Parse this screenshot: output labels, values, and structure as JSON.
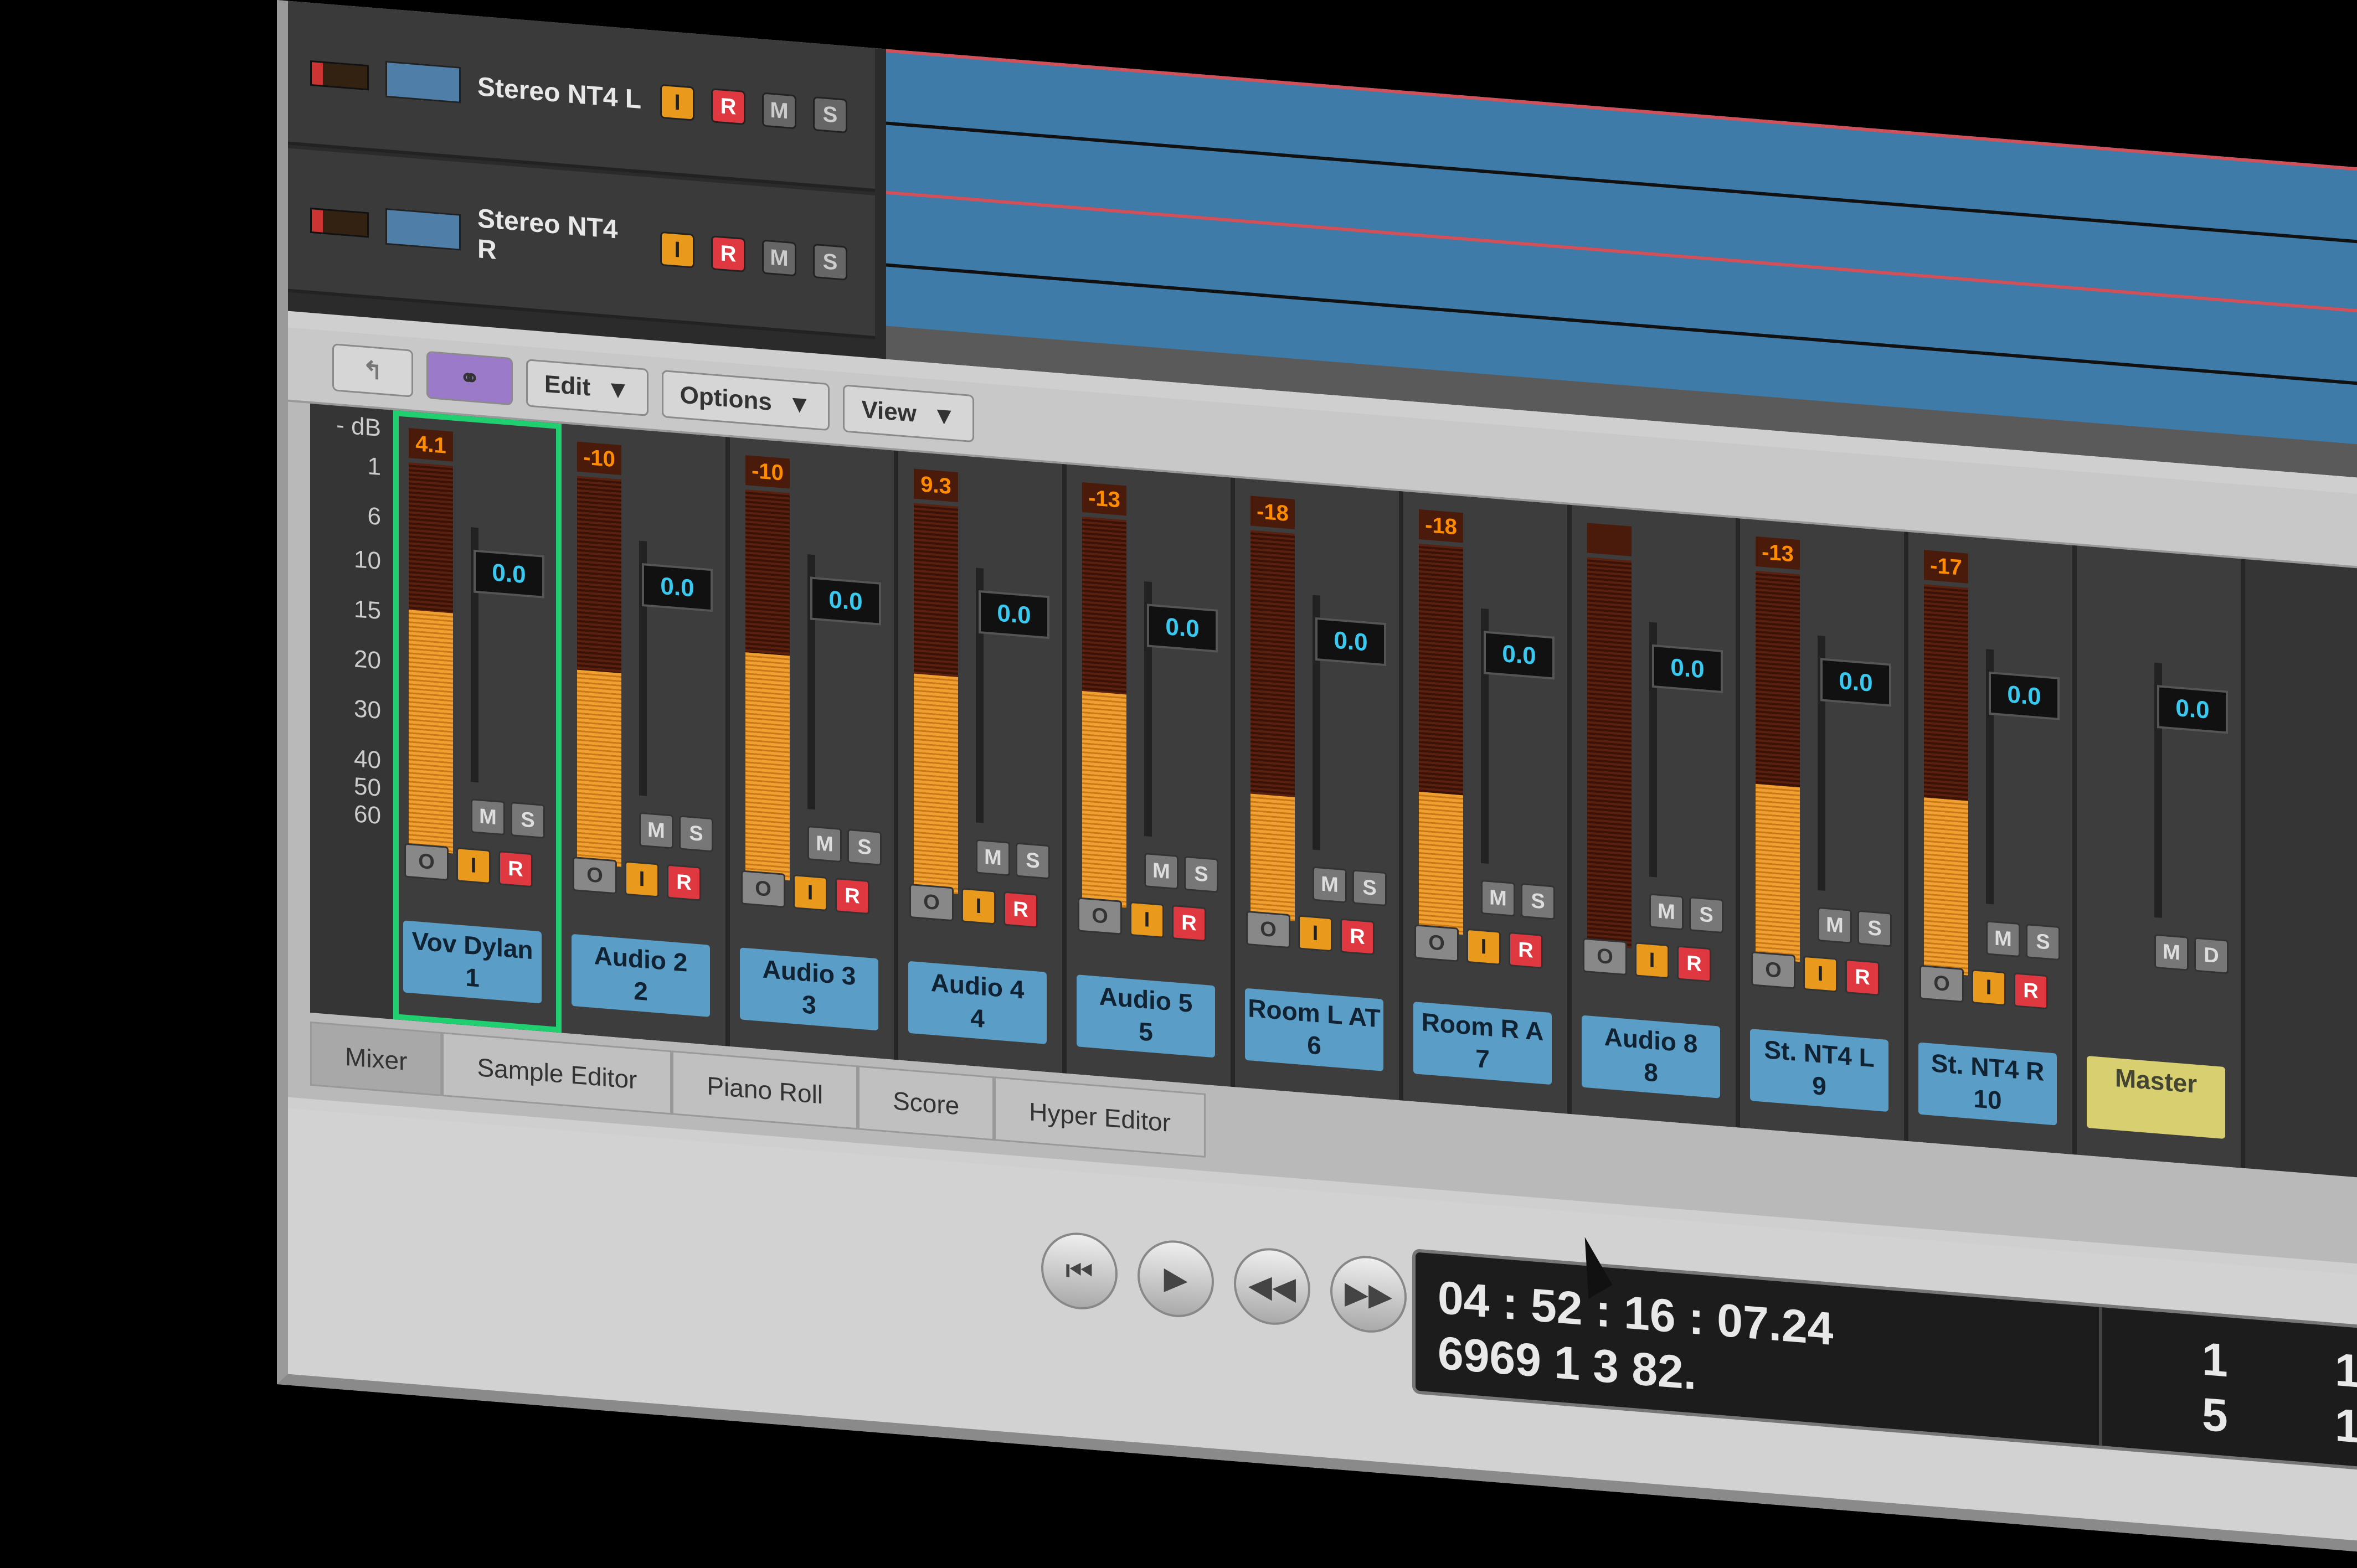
{
  "arrange": {
    "tracks": [
      {
        "name": "Stereo NT4 L",
        "i": "I",
        "r": "R",
        "m": "M",
        "s": "S"
      },
      {
        "name": "Stereo NT4 R",
        "i": "I",
        "r": "R",
        "m": "M",
        "s": "S"
      }
    ]
  },
  "mixer_toolbar": {
    "edit": "Edit",
    "options": "Options",
    "view": "View",
    "dropdown_glyph": "▼"
  },
  "scale": {
    "unit": "- dB",
    "ticks": [
      "1",
      "6",
      "10",
      "15",
      "20",
      "30",
      "40",
      "50",
      "60"
    ]
  },
  "strips": [
    {
      "peak": "4.1",
      "fader": "0.0",
      "name": "Vov Dylan",
      "num": "1",
      "level": 0.62,
      "selected": true
    },
    {
      "peak": "-10",
      "fader": "0.0",
      "name": "Audio 2",
      "num": "2",
      "level": 0.5
    },
    {
      "peak": "-10",
      "fader": "0.0",
      "name": "Audio 3",
      "num": "3",
      "level": 0.58
    },
    {
      "peak": "9.3",
      "fader": "0.0",
      "name": "Audio 4",
      "num": "4",
      "level": 0.56
    },
    {
      "peak": "-13",
      "fader": "0.0",
      "name": "Audio 5",
      "num": "5",
      "level": 0.55
    },
    {
      "peak": "-18",
      "fader": "0.0",
      "name": "Room L AT",
      "num": "6",
      "level": 0.32
    },
    {
      "peak": "-18",
      "fader": "0.0",
      "name": "Room R A",
      "num": "7",
      "level": 0.36
    },
    {
      "peak": "",
      "fader": "0.0",
      "name": "Audio 8",
      "num": "8",
      "level": 0.0
    },
    {
      "peak": "-13",
      "fader": "0.0",
      "name": "St. NT4 L",
      "num": "9",
      "level": 0.45
    },
    {
      "peak": "-17",
      "fader": "0.0",
      "name": "St. NT4 R",
      "num": "10",
      "level": 0.45
    },
    {
      "peak": "",
      "fader": "0.0",
      "name": "Master",
      "num": "",
      "level": 0.0,
      "master": true
    }
  ],
  "strip_buttons": {
    "m": "M",
    "s": "S",
    "o": "O",
    "i": "I",
    "r": "R",
    "d": "D"
  },
  "tabs": [
    "Mixer",
    "Sample Editor",
    "Piano Roll",
    "Score",
    "Hyper Editor"
  ],
  "transport": {
    "glyphs": {
      "start": "⏮",
      "cycle": "▶",
      "rew": "◀◀",
      "ffw": "▶▶",
      "stop": "■",
      "play": "▶",
      "pause": "⏸",
      "record": "●"
    },
    "smpte": "04 : 52 : 16 : 07.24",
    "bars_row": "6969   1   3   82.",
    "right_top": [
      "1",
      "1"
    ],
    "right_bottom": [
      "5",
      "1"
    ]
  },
  "colors": {
    "meter": "#f0a030",
    "fader": "#33c8e8",
    "selected": "#20d070",
    "play": "#2ec040",
    "record": "#e02020"
  }
}
